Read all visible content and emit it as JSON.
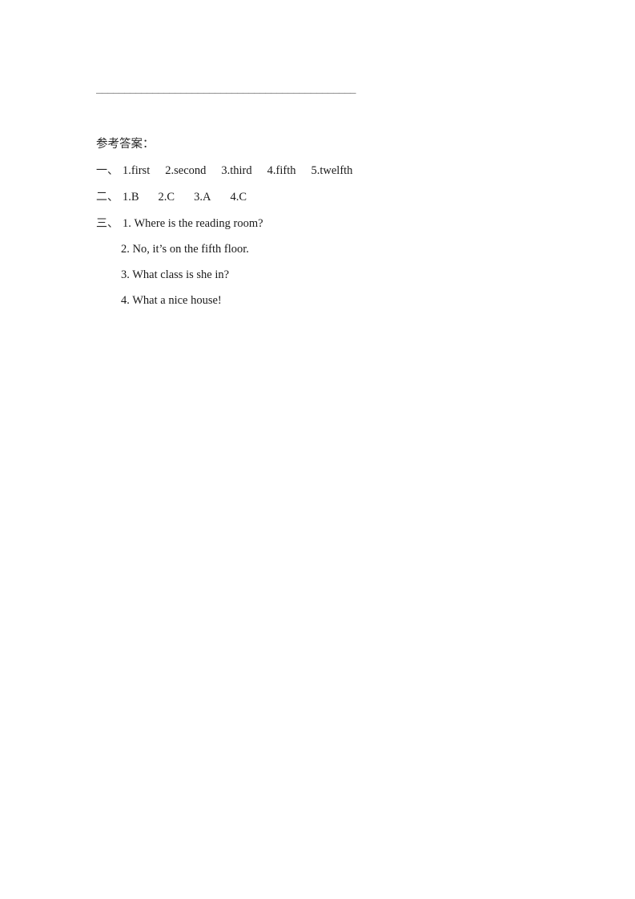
{
  "page": {
    "divider": "______________________________________________",
    "answers_title": "参考答案："
  },
  "sections": [
    {
      "marker": "一、",
      "items": [
        "1.first",
        "2.second",
        "3.third",
        "4.fifth",
        "5.twelfth"
      ]
    },
    {
      "marker": "二、",
      "items": [
        "1.B",
        "2.C",
        "3.A",
        "4.C"
      ]
    }
  ],
  "section3": {
    "marker": "三、",
    "items": [
      "1. Where is the reading room?",
      "2. No, it’s on the fifth floor.",
      "3. What class is she in?",
      "4. What a nice house!"
    ]
  }
}
